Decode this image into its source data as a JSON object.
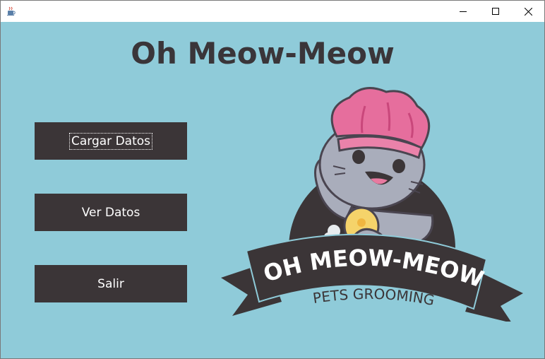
{
  "window": {
    "app_icon": "java-cup-icon",
    "controls": {
      "minimize_icon": "minimize-icon",
      "maximize_icon": "maximize-icon",
      "close_icon": "close-icon"
    }
  },
  "header": {
    "title": "Oh Meow-Meow"
  },
  "menu": {
    "load_label": "Cargar Datos",
    "view_label": "Ver Datos",
    "exit_label": "Salir"
  },
  "logo": {
    "brand_name": "OH MEOW-MEOW",
    "tagline": "PETS GROOMING"
  },
  "colors": {
    "background": "#8fcbd9",
    "button_bg": "#3b3537",
    "title_text": "#3a3539",
    "hat_pink": "#e66e9d",
    "sponge_yellow": "#f5d36a"
  }
}
